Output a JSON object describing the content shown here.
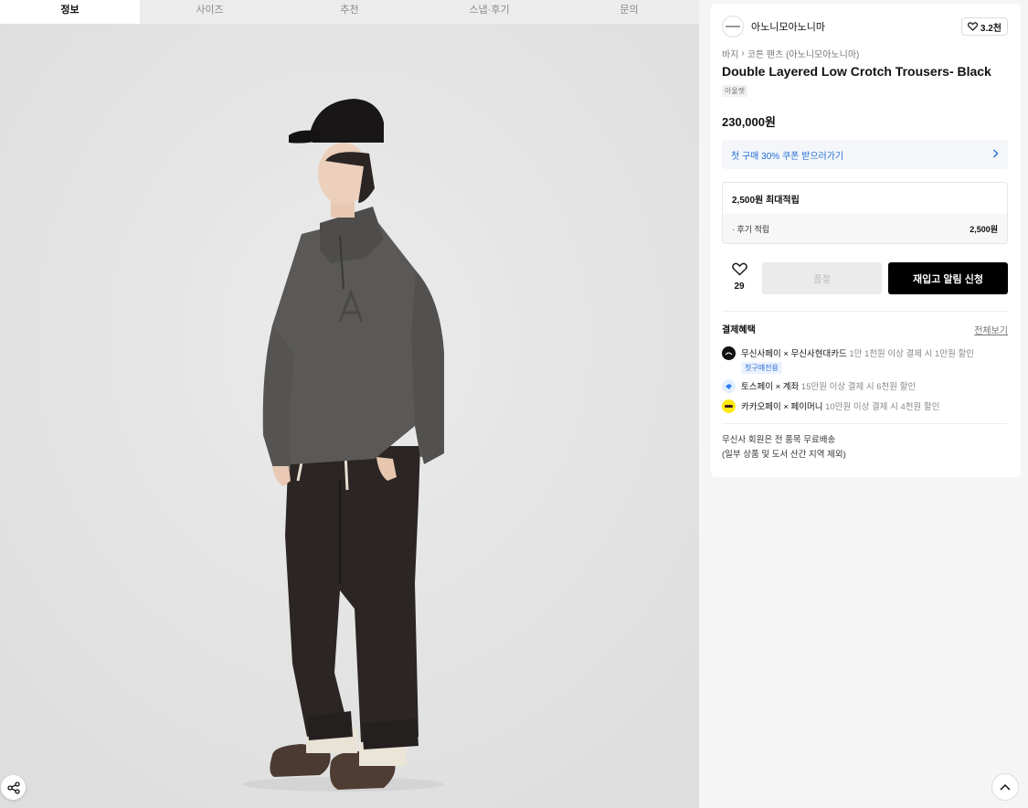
{
  "tabs": [
    {
      "label": "정보",
      "active": true
    },
    {
      "label": "사이즈"
    },
    {
      "label": "추천"
    },
    {
      "label": "스냅·후기"
    },
    {
      "label": "문의"
    }
  ],
  "brand": {
    "name": "아노니모아노니마",
    "likes": "3.2천"
  },
  "breadcrumb": {
    "category": "바지",
    "subcategory": "코튼 팬츠 (아노니모아노니마)"
  },
  "product": {
    "title": "Double Layered Low Crotch Trousers- Black",
    "tag": "아울렛",
    "price": "230,000원"
  },
  "coupon": {
    "text": "첫 구매 30% 쿠폰 받으러가기"
  },
  "points": {
    "max_label": "2,500원 최대적립",
    "review_label": "· 후기 적립",
    "review_value": "2,500원"
  },
  "actions": {
    "wish_count": "29",
    "soldout_label": "품절",
    "restock_label": "재입고 알림 신청"
  },
  "benefits": {
    "title": "결제혜택",
    "view_all": "전체보기",
    "items": [
      {
        "name": "무신사페이 × 무신사현대카드",
        "desc": "1만 1천원 이상 결제 시 1만원 할인",
        "badge": "첫구매전용",
        "icon": "musinsa-pay-icon",
        "color": "#111111"
      },
      {
        "name": "토스페이 × 계좌",
        "desc": "15만원 이상 결제 시 6천원 할인",
        "icon": "toss-pay-icon",
        "color": "#3182f6"
      },
      {
        "name": "카카오페이 × 페이머니",
        "desc": "10만원 이상 결제 시 4천원 할인",
        "icon": "kakao-pay-icon",
        "color": "#ffe812"
      }
    ]
  },
  "shipping": {
    "line1": "무신사 회원은 전 품목 무료배송",
    "line2": "(일부 상품 및 도서 산간 지역 제외)"
  }
}
